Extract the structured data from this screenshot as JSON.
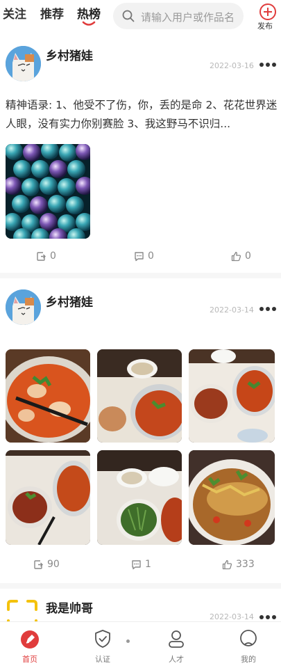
{
  "tabs": [
    {
      "label": "关注",
      "active": false
    },
    {
      "label": "推荐",
      "active": false
    },
    {
      "label": "热榜",
      "active": true
    }
  ],
  "search": {
    "placeholder": "请输入用户或作品名",
    "icon": "search-icon"
  },
  "publish": {
    "label": "发布",
    "icon": "plus-circle-icon",
    "color": "#e03c3c"
  },
  "posts": [
    {
      "username": "乡村猪娃",
      "date": "2022-03-16",
      "text": "精神语录: 1、他受不了伤，你，丢的是命 2、花花世界迷人眼，没有实力你别赛脸 3、我这野马不识归...",
      "share": "0",
      "comment": "0",
      "like": "0"
    },
    {
      "username": "乡村猪娃",
      "date": "2022-03-14",
      "share": "90",
      "comment": "1",
      "like": "333"
    },
    {
      "username": "我是帅哥",
      "date": "2022-03-14"
    }
  ],
  "bottom_nav": [
    {
      "label": "首页",
      "icon": "home-icon",
      "active": true
    },
    {
      "label": "认证",
      "icon": "shield-check-icon",
      "active": false
    },
    {
      "label": "人才",
      "icon": "person-icon",
      "active": false
    },
    {
      "label": "我的",
      "icon": "profile-icon",
      "active": false
    }
  ],
  "colors": {
    "accent": "#e03c3c",
    "muted": "#888888",
    "date": "#b8b8b8"
  }
}
